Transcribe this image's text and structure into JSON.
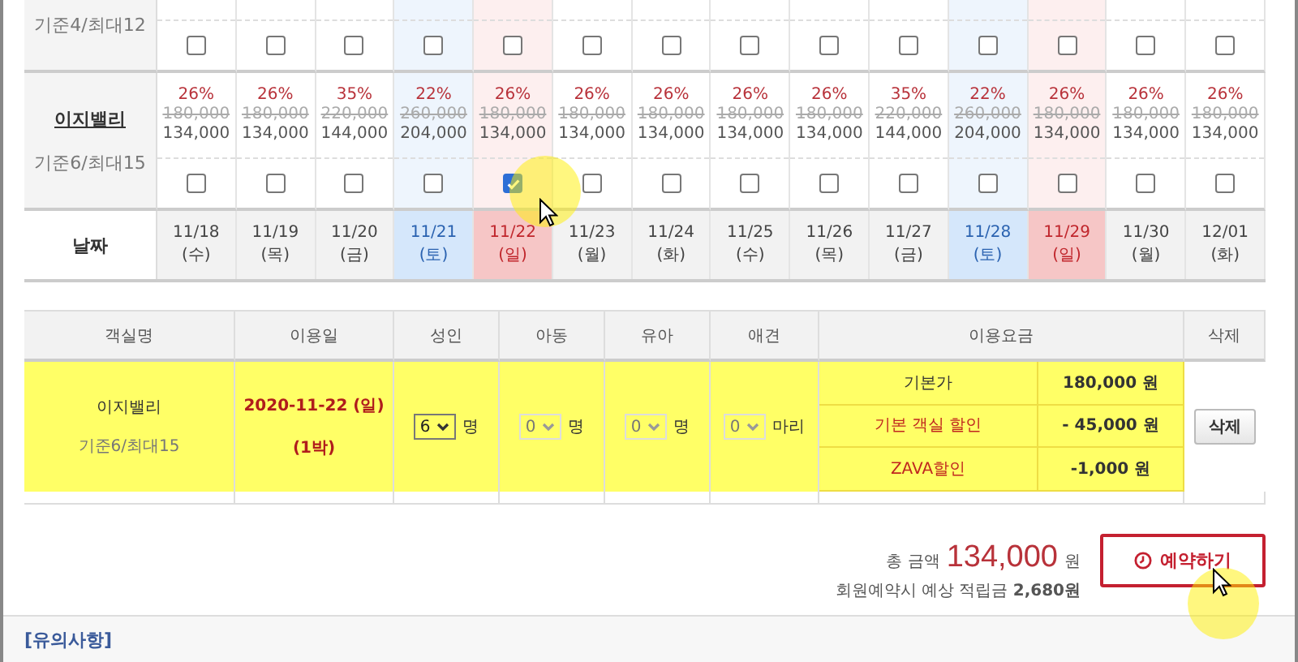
{
  "room_grid": {
    "rows": [
      {
        "capacity": "기준4/최대12",
        "cells": [
          {
            "checked": false
          },
          {
            "checked": false
          },
          {
            "checked": false
          },
          {
            "checked": false
          },
          {
            "checked": false
          },
          {
            "checked": false
          },
          {
            "checked": false
          },
          {
            "checked": false
          },
          {
            "checked": false
          },
          {
            "checked": false
          },
          {
            "checked": false
          },
          {
            "checked": false
          },
          {
            "checked": false
          },
          {
            "checked": false
          }
        ]
      },
      {
        "name": "이지밸리",
        "capacity": "기준6/최대15",
        "cells": [
          {
            "discount": "26%",
            "original": "180,000",
            "price": "134,000",
            "checked": false
          },
          {
            "discount": "26%",
            "original": "180,000",
            "price": "134,000",
            "checked": false
          },
          {
            "discount": "35%",
            "original": "220,000",
            "price": "144,000",
            "checked": false
          },
          {
            "discount": "22%",
            "original": "260,000",
            "price": "204,000",
            "checked": false
          },
          {
            "discount": "26%",
            "original": "180,000",
            "price": "134,000",
            "checked": true
          },
          {
            "discount": "26%",
            "original": "180,000",
            "price": "134,000",
            "checked": false
          },
          {
            "discount": "26%",
            "original": "180,000",
            "price": "134,000",
            "checked": false
          },
          {
            "discount": "26%",
            "original": "180,000",
            "price": "134,000",
            "checked": false
          },
          {
            "discount": "26%",
            "original": "180,000",
            "price": "134,000",
            "checked": false
          },
          {
            "discount": "35%",
            "original": "220,000",
            "price": "144,000",
            "checked": false
          },
          {
            "discount": "22%",
            "original": "260,000",
            "price": "204,000",
            "checked": false
          },
          {
            "discount": "26%",
            "original": "180,000",
            "price": "134,000",
            "checked": false
          },
          {
            "discount": "26%",
            "original": "180,000",
            "price": "134,000",
            "checked": false
          },
          {
            "discount": "26%",
            "original": "180,000",
            "price": "134,000",
            "checked": false
          }
        ]
      }
    ],
    "date_label": "날짜",
    "dates": [
      {
        "date": "11/18",
        "day": "(수)",
        "kind": "weekday"
      },
      {
        "date": "11/19",
        "day": "(목)",
        "kind": "weekday"
      },
      {
        "date": "11/20",
        "day": "(금)",
        "kind": "weekday"
      },
      {
        "date": "11/21",
        "day": "(토)",
        "kind": "saturday"
      },
      {
        "date": "11/22",
        "day": "(일)",
        "kind": "sunday"
      },
      {
        "date": "11/23",
        "day": "(월)",
        "kind": "weekday"
      },
      {
        "date": "11/24",
        "day": "(화)",
        "kind": "weekday"
      },
      {
        "date": "11/25",
        "day": "(수)",
        "kind": "weekday"
      },
      {
        "date": "11/26",
        "day": "(목)",
        "kind": "weekday"
      },
      {
        "date": "11/27",
        "day": "(금)",
        "kind": "weekday"
      },
      {
        "date": "11/28",
        "day": "(토)",
        "kind": "saturday"
      },
      {
        "date": "11/29",
        "day": "(일)",
        "kind": "sunday"
      },
      {
        "date": "11/30",
        "day": "(월)",
        "kind": "weekday"
      },
      {
        "date": "12/01",
        "day": "(화)",
        "kind": "weekday"
      }
    ]
  },
  "booking_table": {
    "columns": [
      "객실명",
      "이용일",
      "성인",
      "아동",
      "유아",
      "애견",
      "이용요금",
      "삭제"
    ],
    "row": {
      "room": "이지밸리",
      "capacity": "기준6/최대15",
      "date": "2020-11-22 (일)",
      "nights": "(1박)",
      "counts": [
        {
          "value": "6",
          "unit": "명",
          "disabled": false
        },
        {
          "value": "0",
          "unit": "명",
          "disabled": true
        },
        {
          "value": "0",
          "unit": "명",
          "disabled": true
        },
        {
          "value": "0",
          "unit": "마리",
          "disabled": true
        }
      ],
      "fees": [
        {
          "label": "기본가",
          "amount": "180,000 원",
          "kind": "base"
        },
        {
          "label": "기본 객실 할인",
          "amount": "- 45,000 원",
          "kind": "discount"
        },
        {
          "label": "ZAVA할인",
          "amount": "-1,000 원",
          "kind": "discount"
        }
      ],
      "delete_button": "삭제"
    }
  },
  "summary": {
    "total_label": "총 금액",
    "total": "134,000",
    "currency": "원",
    "points": "회원예약시 예상 적립금 **2,680원**",
    "reserve_button": "예약하기"
  },
  "notice": {
    "title": "[유의사항]"
  }
}
